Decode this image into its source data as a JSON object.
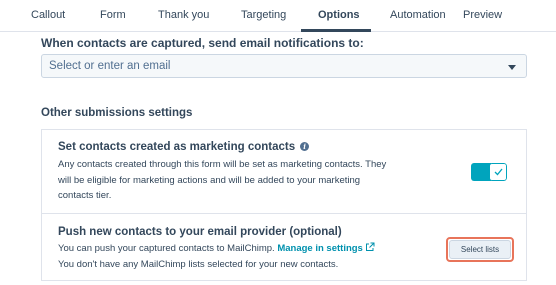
{
  "tabs": [
    {
      "label": "Callout"
    },
    {
      "label": "Form"
    },
    {
      "label": "Thank you"
    },
    {
      "label": "Targeting"
    },
    {
      "label": "Options",
      "active": true
    },
    {
      "label": "Automation"
    },
    {
      "label": "Preview"
    }
  ],
  "notifications": {
    "label": "When contacts are captured, send email notifications to:",
    "placeholder": "Select or enter an email"
  },
  "other_settings": {
    "heading": "Other submissions settings",
    "marketing": {
      "title": "Set contacts created as marketing contacts",
      "description": "Any contacts created through this form will be set as marketing contacts. They will be eligible for marketing actions and will be added to your marketing contacts tier.",
      "toggle_on": true
    },
    "email_provider": {
      "title": "Push new contacts to your email provider (optional)",
      "description_prefix": "You can push your captured contacts to MailChimp.",
      "link_label": "Manage in settings",
      "description_line2": "You don't have any MailChimp lists selected for your new contacts.",
      "button_label": "Select lists"
    }
  },
  "colors": {
    "accent": "#00a4bd",
    "link": "#0091ae",
    "highlight": "#e8745a",
    "text": "#33475b"
  },
  "icons": [
    "info-icon",
    "external-link-icon",
    "checkmark-icon",
    "chevron-down-icon"
  ]
}
